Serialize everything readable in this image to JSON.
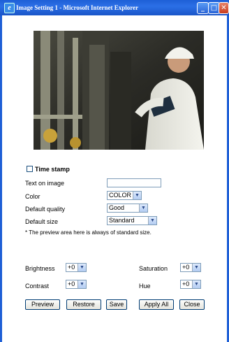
{
  "window": {
    "title": "Image Setting 1 - Microsoft Internet Explorer",
    "minimize_icon": "minimize-icon",
    "maximize_icon": "maximize-icon",
    "close_icon": "close-icon"
  },
  "preview": {
    "image": "industrial-worker-photo"
  },
  "form": {
    "timestamp_label": "Time stamp",
    "timestamp_checked": false,
    "text_on_image_label": "Text on image",
    "text_on_image_value": "",
    "color_label": "Color",
    "color_value": "COLOR",
    "quality_label": "Default quality",
    "quality_value": "Good",
    "size_label": "Default size",
    "size_value": "Standard",
    "note": "* The preview area here is always of standard size."
  },
  "adjust": {
    "brightness_label": "Brightness",
    "brightness_value": "+0",
    "contrast_label": "Contrast",
    "contrast_value": "+0",
    "saturation_label": "Saturation",
    "saturation_value": "+0",
    "hue_label": "Hue",
    "hue_value": "+0"
  },
  "buttons": {
    "preview": "Preview",
    "restore": "Restore",
    "save": "Save",
    "apply_all": "Apply All",
    "close": "Close"
  },
  "colors": {
    "titlebar": "#1e5fd6",
    "close_button": "#c83c1d"
  }
}
